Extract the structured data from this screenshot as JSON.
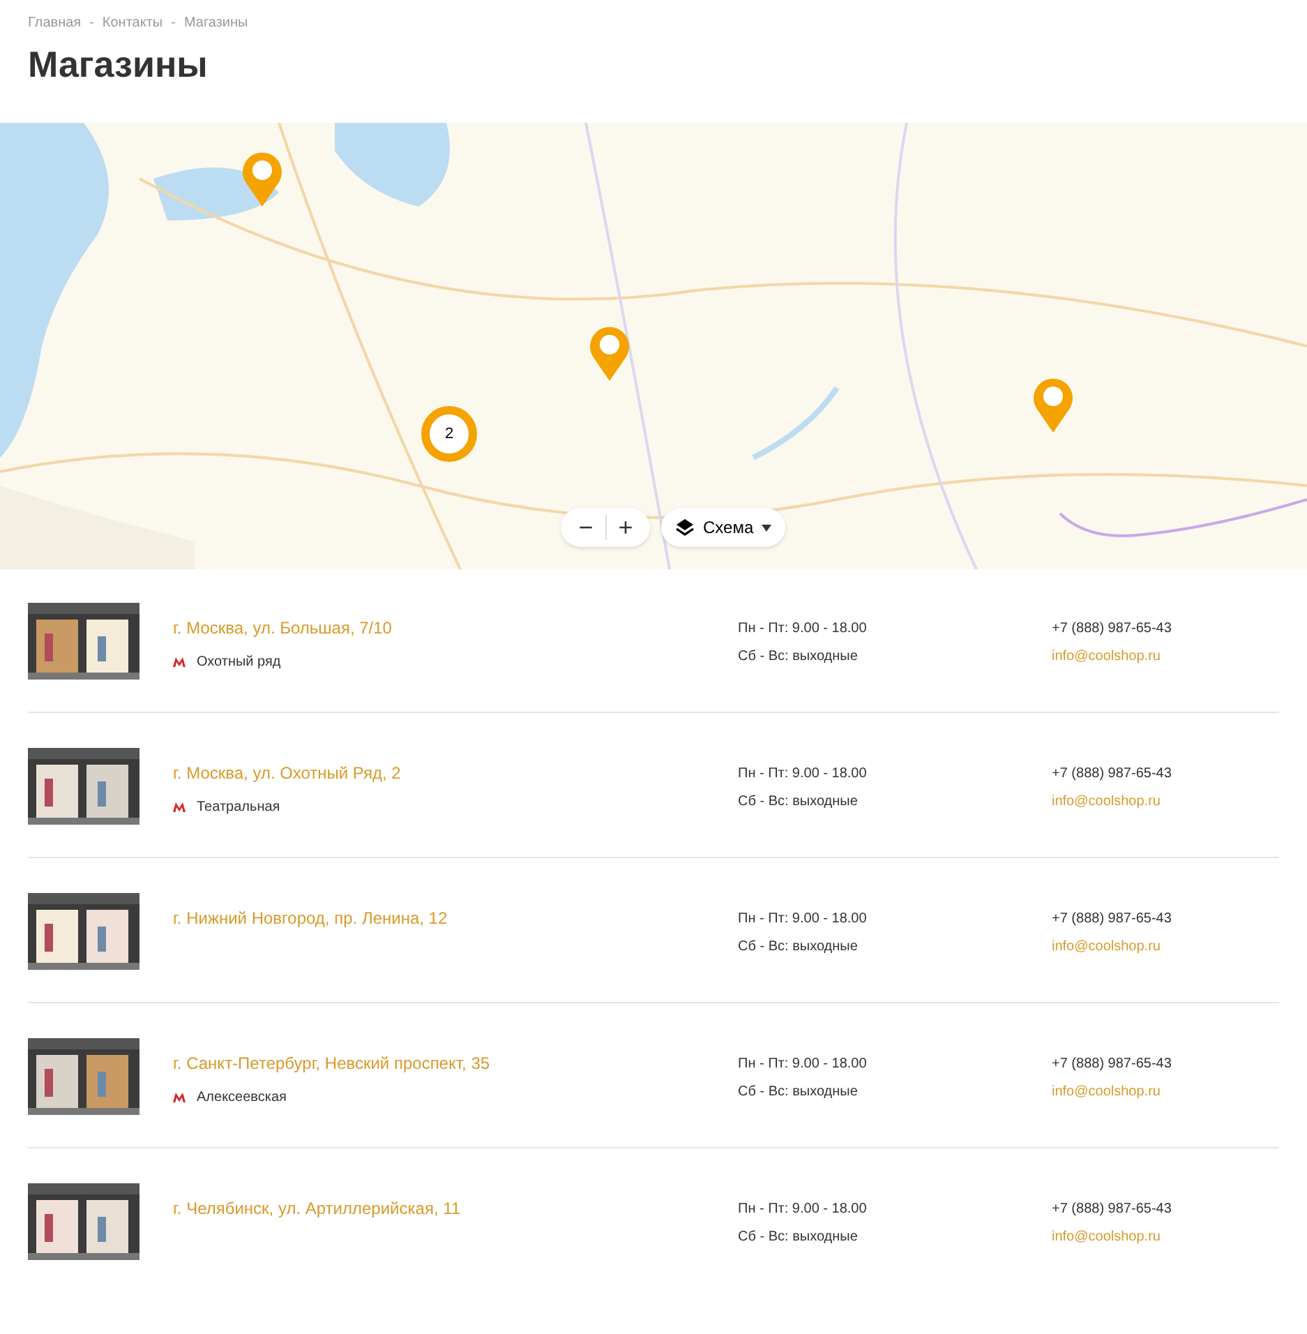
{
  "breadcrumbs": [
    "Главная",
    "Контакты",
    "Магазины"
  ],
  "breadcrumb_separator": "-",
  "title": "Магазины",
  "map": {
    "kind": "picture",
    "markers": [
      {
        "kind": "pin"
      },
      {
        "kind": "pin"
      },
      {
        "kind": "cluster",
        "label": "2"
      },
      {
        "kind": "pin"
      }
    ],
    "zoom_out": "−",
    "zoom_in": "+",
    "layer_button": "Схема"
  },
  "stores": [
    {
      "address": "г. Москва, ул. Большая, 7/10",
      "metro": "Охотный ряд",
      "hours": [
        "Пн - Пт: 9.00 - 18.00",
        "Сб - Вс: выходные"
      ],
      "phone": "+7 (888) 987-65-43",
      "email": "info@coolshop.ru"
    },
    {
      "address": "г. Москва, ул. Охотный Ряд, 2",
      "metro": "Театральная",
      "hours": [
        "Пн - Пт: 9.00 - 18.00",
        "Сб - Вс: выходные"
      ],
      "phone": "+7 (888) 987-65-43",
      "email": "info@coolshop.ru"
    },
    {
      "address": "г. Нижний Новгород, пр. Ленина, 12",
      "hours": [
        "Пн - Пт: 9.00 - 18.00",
        "Сб - Вс: выходные"
      ],
      "phone": "+7 (888) 987-65-43",
      "email": "info@coolshop.ru"
    },
    {
      "address": "г. Санкт-Петербург, Невский проспект, 35",
      "metro": "Алексеевская",
      "hours": [
        "Пн - Пт: 9.00 - 18.00",
        "Сб - Вс: выходные"
      ],
      "phone": "+7 (888) 987-65-43",
      "email": "info@coolshop.ru"
    },
    {
      "address": "г. Челябинск, ул. Артиллерийская, 11",
      "hours": [
        "Пн - Пт: 9.00 - 18.00",
        "Сб - Вс: выходные"
      ],
      "phone": "+7 (888) 987-65-43",
      "email": "info@coolshop.ru"
    }
  ]
}
